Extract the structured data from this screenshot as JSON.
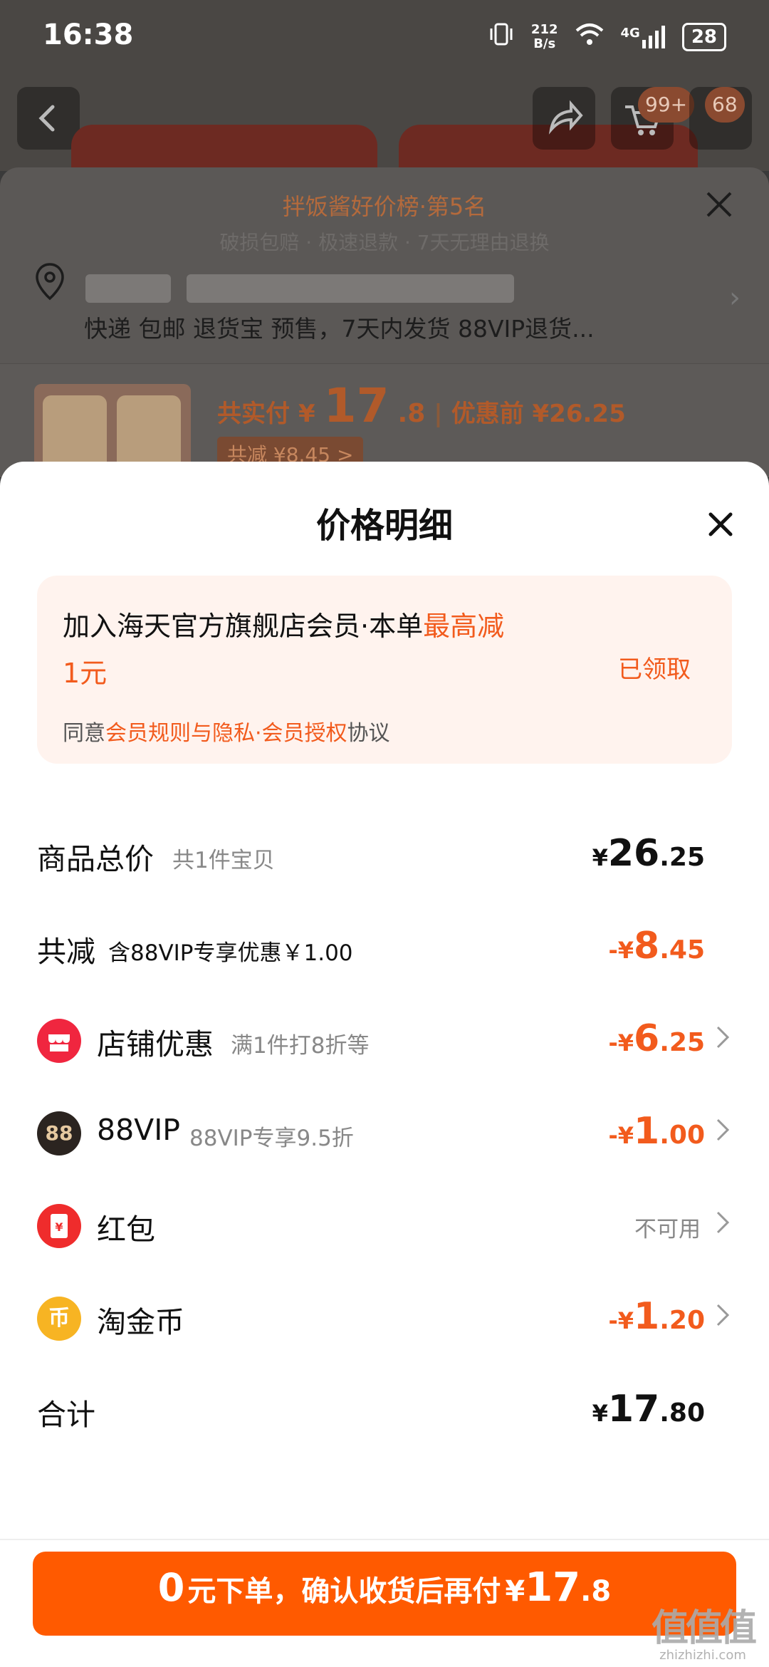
{
  "status_bar": {
    "time": "16:38",
    "net_speed_top": "212",
    "net_speed_bottom": "B/s",
    "network": "4G",
    "battery": "28"
  },
  "background": {
    "cart_count": "99+",
    "message_count": "68",
    "rank_text": "拌饭酱好价榜·第5名",
    "sub_text": "破损包赔 · 极速退款 · 7天无理由退换",
    "shipping_text": "快递 包邮 退货宝 预售，7天内发货 88VIP退货...",
    "price_label": "共实付",
    "price_currency": "¥",
    "price_int": "17",
    "price_dec": ".8",
    "price_separator": "|",
    "price_before": "优惠前 ¥26.25",
    "reduce_tag": "共减 ¥8.45 >"
  },
  "modal": {
    "title": "价格明细",
    "member": {
      "line_prefix": "加入海天官方旗舰店会员·本单",
      "line_highlight": "最高减1元",
      "claim_label": "已领取",
      "agree_prefix": "同意",
      "agree_link": "会员规则与隐私·会员授权",
      "agree_suffix": "协议"
    },
    "rows": {
      "total": {
        "title": "商品总价",
        "note": "共1件宝贝",
        "cur": "¥",
        "int": "26",
        "dec": ".25"
      },
      "reduce": {
        "title": "共减",
        "note": "含88VIP专享优惠￥1.00",
        "cur": "-¥",
        "int": "8",
        "dec": ".45"
      },
      "shop": {
        "title": "店铺优惠",
        "note": "满1件打8折等",
        "cur": "-¥",
        "int": "6",
        "dec": ".25"
      },
      "vip": {
        "title": "88VIP",
        "note": "88VIP专享9.5折",
        "cur": "-¥",
        "int": "1",
        "dec": ".00"
      },
      "redpacket": {
        "title": "红包",
        "value": "不可用"
      },
      "coin": {
        "title": "淘金币",
        "cur": "-¥",
        "int": "1",
        "dec": ".20"
      },
      "sum": {
        "title": "合计",
        "cur": "¥",
        "int": "17",
        "dec": ".80"
      }
    },
    "icons": {
      "shop_icon_color": "#f0263f",
      "vip_icon_color": "#2b2420",
      "vip_icon_text": "88",
      "redpacket_icon_color": "#ef2c2c",
      "redpacket_icon_text": "¥",
      "coin_icon_color": "#f7b423",
      "coin_icon_text": "币"
    },
    "cta": {
      "zero": "0",
      "text": "元下单，确认收货后再付",
      "cur": "¥",
      "int": "17",
      "dec": ".8"
    }
  },
  "watermark": {
    "main": "值值值",
    "sub": "zhizhizhi.com"
  },
  "colors": {
    "accent": "#f25b1d",
    "cta": "#ff5a00",
    "member_bg": "#fff3ee"
  }
}
